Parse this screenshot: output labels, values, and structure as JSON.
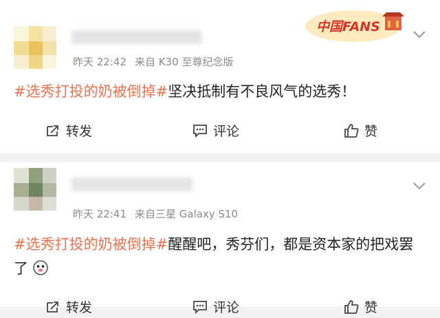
{
  "badge": {
    "text": "中国FANS"
  },
  "posts": [
    {
      "time": "昨天 22:42",
      "source": "来自 K30 至尊纪念版",
      "hashtag": "#选秀打投的奶被倒掉#",
      "body": "坚决抵制有不良风气的选秀！",
      "actions": {
        "repost": "转发",
        "comment": "评论",
        "like": "赞"
      }
    },
    {
      "time": "昨天 22:41",
      "source": "来自三星 Galaxy S10",
      "hashtag": "#选秀打投的奶被倒掉#",
      "body": "醒醒吧，秀芬们，都是资本家的把戏罢了",
      "actions": {
        "repost": "转发",
        "comment": "评论",
        "like": "赞"
      }
    }
  ]
}
